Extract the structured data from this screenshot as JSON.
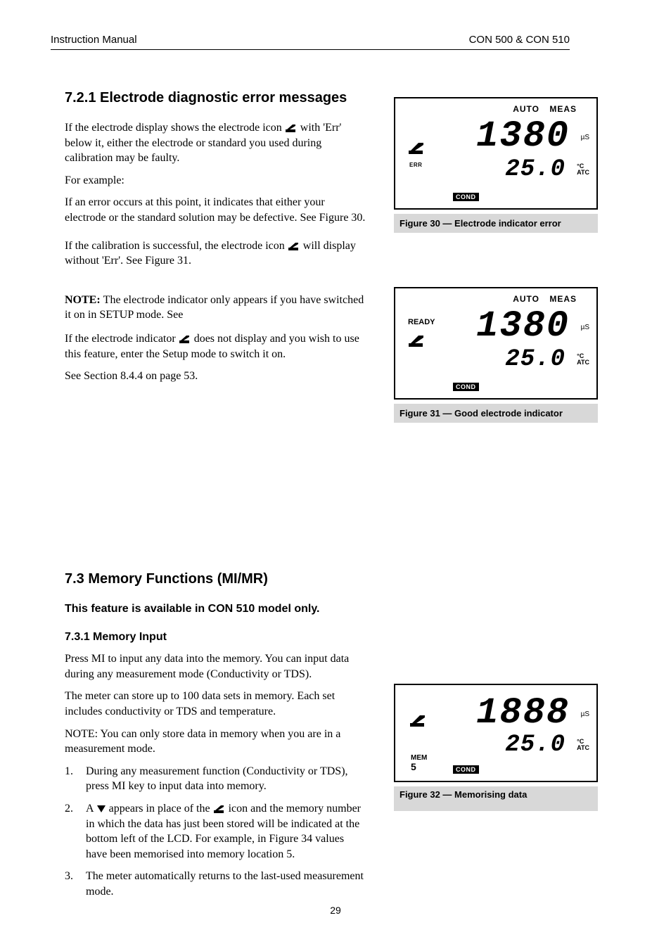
{
  "header": {
    "left": "Instruction Manual",
    "right": "CON 500 & CON 510"
  },
  "section721": {
    "title": "7.2.1  Electrode diagnostic error messages",
    "p1": {
      "a": "If the electrode display shows the electrode icon ",
      "b": "with 'Err' below it, either the electrode or standard you used during calibration may be faulty."
    },
    "p2": "For example:",
    "p3": "If an error occurs at this point, it indicates that either your electrode or the standard solution may be defective. See Figure 30.",
    "p4": {
      "a": "If the calibration is successful, the electrode icon ",
      "b": "will display without 'Err'. See Figure 31."
    },
    "note": {
      "a": "NOTE: ",
      "b": "The electrode indicator only appears if you have switched it on in SETUP mode. See "
    },
    "p5": {
      "a": "If the electrode indicator ",
      "b": " does not display and you wish to use this feature, enter the Setup mode to switch it on."
    },
    "p6": "See Section 8.4.4 on page 53."
  },
  "section73": {
    "title": "7.3  Memory Functions (MI/MR)",
    "intro": "This feature is available in CON 510 model only.",
    "sub731": "7.3.1  Memory Input",
    "p1": "Press MI to input any data into the memory. You can input data during any measurement mode (Conductivity or TDS).",
    "p2": "The meter can store up to 100 data sets in memory. Each set includes conductivity or TDS and temperature.",
    "p3": "NOTE: You can only store data in memory when you are in a measurement mode.",
    "step1": {
      "num": "1.",
      "text": "During any measurement function (Conductivity or TDS), press MI key to input data into memory."
    },
    "step2": {
      "num": "2.",
      "a": "A ",
      "b": " appears in place of the ",
      "c": " icon and the memory number in which the data has just been stored will be indicated at the bottom left of the LCD. For example, in Figure 34 values have been memorised into memory location 5."
    },
    "step3": {
      "num": "3.",
      "text": "The meter automatically returns to the last-used measurement mode."
    }
  },
  "figures": {
    "f30": {
      "auto": "AUTO",
      "meas": "MEAS",
      "main": "1380",
      "main_unit": "µS",
      "sec": "25.0",
      "sec_unit": "°C\nATC",
      "mode": "COND",
      "err": "ERR",
      "caption": "Figure 30 — Electrode indicator error"
    },
    "f31": {
      "auto": "AUTO",
      "meas": "MEAS",
      "ready": "READY",
      "main": "1380",
      "main_unit": "µS",
      "sec": "25.0",
      "sec_unit": "°C\nATC",
      "mode": "COND",
      "caption": "Figure 31 — Good electrode indicator"
    },
    "fMem": {
      "main": "1888",
      "main_unit": "µS",
      "sec": "25.0",
      "sec_unit": "°C\nATC",
      "mode": "COND",
      "mem_label": "MEM",
      "mem_num": "5",
      "caption": "Figure 32 — Memorising data"
    }
  },
  "page_number": "29"
}
